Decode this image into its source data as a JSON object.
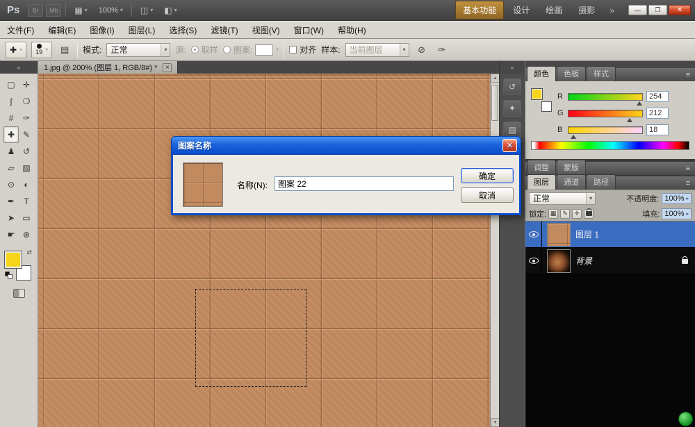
{
  "colors": {
    "foreground": "#f6d41a",
    "selected_layer_blue": "#3a6cc0",
    "dialog_title_blue": "#1257d6",
    "canvas_base": "#c28a5f",
    "workspace_active_tan": "#a5752e"
  },
  "icons": {
    "dropdown_arrow": "▾",
    "spinner_arrow": "▸",
    "panel_menu": "≡",
    "collapse_left": "«",
    "more_right": "»",
    "close_x": "✕",
    "small_close": "×",
    "scroll_up": "▲",
    "scroll_down": "▼",
    "minimize": "—",
    "restore": "❐"
  },
  "titlebar": {
    "logo": "Ps",
    "bridge_icon_label": "Br",
    "media_icon_label": "Mb",
    "view_extras_icon": "▦",
    "zoom_level": "100%",
    "arrange_documents_icon": "◫",
    "screen_mode_icon": "◧",
    "workspaces": [
      {
        "label": "基本功能"
      },
      {
        "label": "设计"
      },
      {
        "label": "绘画"
      },
      {
        "label": "摄影"
      }
    ]
  },
  "menubar": {
    "items": [
      "文件(F)",
      "编辑(E)",
      "图像(I)",
      "图层(L)",
      "选择(S)",
      "滤镜(T)",
      "视图(V)",
      "窗口(W)",
      "帮助(H)"
    ]
  },
  "options_bar": {
    "tool_icon": "✚",
    "brush_size": "19",
    "panel_toggle_icon": "▤",
    "mode_label": "模式:",
    "mode_value": "正常",
    "source_label": "源:",
    "sampled_label": "取样",
    "pattern_label": "图案:",
    "aligned_label": "对齐",
    "sample_label": "样本:",
    "sample_value": "当前图层",
    "ignore_adjustment_icon": "⊘",
    "airbrush_icon": "✑"
  },
  "tool_panel": {
    "tools": [
      {
        "id": "rectangular-marquee-tool",
        "glyph": "▢"
      },
      {
        "id": "move-tool",
        "glyph": "✛"
      },
      {
        "id": "lasso-tool",
        "glyph": "ʃ"
      },
      {
        "id": "quick-selection-tool",
        "glyph": "❍"
      },
      {
        "id": "crop-tool",
        "glyph": "#"
      },
      {
        "id": "eyedropper-tool",
        "glyph": "✑"
      },
      {
        "id": "healing-brush-tool",
        "glyph": "✚",
        "selected": true
      },
      {
        "id": "brush-tool",
        "glyph": "✎"
      },
      {
        "id": "clone-stamp-tool",
        "glyph": "♟"
      },
      {
        "id": "history-brush-tool",
        "glyph": "↺"
      },
      {
        "id": "eraser-tool",
        "glyph": "▱"
      },
      {
        "id": "gradient-tool",
        "glyph": "▨"
      },
      {
        "id": "blur-tool",
        "glyph": "⊙"
      },
      {
        "id": "dodge-tool",
        "glyph": "◐"
      },
      {
        "id": "pen-tool",
        "glyph": "✒"
      },
      {
        "id": "type-tool",
        "glyph": "T"
      },
      {
        "id": "path-selection-tool",
        "glyph": "➤"
      },
      {
        "id": "rectangle-tool",
        "glyph": "▭"
      },
      {
        "id": "hand-tool",
        "glyph": "☛"
      },
      {
        "id": "zoom-tool",
        "glyph": "⊕"
      }
    ]
  },
  "document": {
    "tab_title": "1.jpg @ 200% (图层 1, RGB/8#) *"
  },
  "dock_strip": {
    "icons": [
      {
        "id": "history-panel-icon",
        "glyph": "↺"
      },
      {
        "id": "styles-panel-icon",
        "glyph": "✦"
      },
      {
        "id": "info-panel-icon",
        "glyph": "▤"
      }
    ]
  },
  "color_panel": {
    "tabs": [
      "颜色",
      "色板",
      "样式"
    ],
    "channels": [
      {
        "label": "R",
        "value": "254"
      },
      {
        "label": "G",
        "value": "212"
      },
      {
        "label": "B",
        "value": "18"
      }
    ]
  },
  "adjustments_panel": {
    "tabs": [
      "调整",
      "蒙版"
    ]
  },
  "layers_panel": {
    "tabs": [
      "图层",
      "通道",
      "路径"
    ],
    "blend_mode_value": "正常",
    "opacity_label": "不透明度:",
    "opacity_value": "100%",
    "lock_label": "锁定:",
    "lock_icons": [
      "▦",
      "✎",
      "✛"
    ],
    "fill_label": "填充:",
    "fill_value": "100%",
    "layers": [
      {
        "name": "图层 1",
        "selected": true
      },
      {
        "name": "背景",
        "selected": false,
        "locked": true
      }
    ]
  },
  "dialog": {
    "title": "图案名称",
    "name_label": "名称(N):",
    "name_value": "图案 22",
    "ok_label": "确定",
    "cancel_label": "取消"
  }
}
